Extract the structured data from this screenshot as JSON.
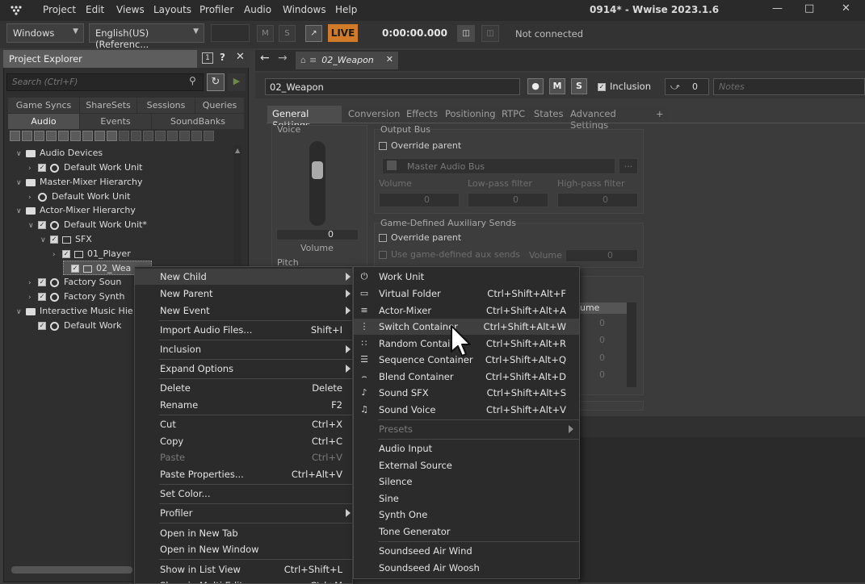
{
  "app": {
    "title": "0914* - Wwise 2023.1.6"
  },
  "menubar": [
    "Project",
    "Edit",
    "Views",
    "Layouts",
    "Profiler",
    "Audio",
    "Windows",
    "Help"
  ],
  "toolbar": {
    "layout_dropdown": "Windows",
    "language_dropdown": "English(US) (Referenc...",
    "mute_label": "M",
    "solo_label": "S",
    "live_label": "LIVE",
    "timecode": "0:00:00.000",
    "connection_status": "Not connected"
  },
  "project_explorer": {
    "title": "Project Explorer",
    "badge": "1",
    "search_placeholder": "Search (Ctrl+F)",
    "tabs_row1": [
      "Game Syncs",
      "ShareSets",
      "Sessions",
      "Queries"
    ],
    "tabs_row2": [
      "Audio",
      "Events",
      "SoundBanks"
    ],
    "tree": [
      {
        "label": "Audio Devices"
      },
      {
        "label": "Default Work Unit"
      },
      {
        "label": "Master-Mixer Hierarchy"
      },
      {
        "label": "Default Work Unit"
      },
      {
        "label": "Actor-Mixer Hierarchy"
      },
      {
        "label": "Default Work Unit*"
      },
      {
        "label": "SFX"
      },
      {
        "label": "01_Player"
      },
      {
        "label": "02_Wea"
      },
      {
        "label": "Factory Soun"
      },
      {
        "label": "Factory Synth"
      },
      {
        "label": "Interactive Music Hie"
      },
      {
        "label": "Default Work"
      }
    ]
  },
  "property_editor": {
    "tab_title": "02_Weapon",
    "object_name": "02_Weapon",
    "mute_label": "M",
    "solo_label": "S",
    "inclusion_label": "Inclusion",
    "share_count": "0",
    "notes_placeholder": "Notes",
    "tabs": [
      "General Settings",
      "Conversion",
      "Effects",
      "Positioning",
      "RTPC",
      "States",
      "Advanced Settings",
      "+"
    ],
    "voice_label": "Voice",
    "volume_value": "0",
    "volume_label": "Volume",
    "pitch_label": "Pitch",
    "output_bus_label": "Output Bus",
    "override_parent_label": "Override parent",
    "master_bus": "Master Audio Bus",
    "browse_label": "...",
    "bus_fields": [
      {
        "label": "Volume",
        "value": "0"
      },
      {
        "label": "Low-pass filter",
        "value": "0"
      },
      {
        "label": "High-pass filter",
        "value": "0"
      }
    ],
    "aux_sends_label": "Game-Defined Auxiliary Sends",
    "aux_override_label": "Override parent",
    "use_aux_label": "Use game-defined aux sends",
    "aux_volume_label": "Volume",
    "aux_volume_value": "0",
    "table_header": "ume",
    "table_values": [
      "0",
      "0",
      "0",
      "0"
    ]
  },
  "context_menu": {
    "items": [
      {
        "label": "New Child",
        "shortcut": "",
        "submenu": true
      },
      {
        "label": "New Parent",
        "shortcut": "",
        "submenu": true
      },
      {
        "label": "New Event",
        "shortcut": "",
        "submenu": true
      },
      {
        "label": "Import Audio Files...",
        "shortcut": "Shift+I"
      },
      {
        "label": "Inclusion",
        "shortcut": "",
        "submenu": true
      },
      {
        "label": "Expand Options",
        "shortcut": "",
        "submenu": true
      },
      {
        "label": "Delete",
        "shortcut": "Delete"
      },
      {
        "label": "Rename",
        "shortcut": "F2"
      },
      {
        "label": "Cut",
        "shortcut": "Ctrl+X"
      },
      {
        "label": "Copy",
        "shortcut": "Ctrl+C"
      },
      {
        "label": "Paste",
        "shortcut": "Ctrl+V"
      },
      {
        "label": "Paste Properties...",
        "shortcut": "Ctrl+Alt+V"
      },
      {
        "label": "Set Color...",
        "shortcut": ""
      },
      {
        "label": "Profiler",
        "shortcut": "",
        "submenu": true
      },
      {
        "label": "Open in New Tab",
        "shortcut": ""
      },
      {
        "label": "Open in New Window",
        "shortcut": ""
      },
      {
        "label": "Show in List View",
        "shortcut": "Ctrl+Shift+L"
      },
      {
        "label": "Show in Multi Edit",
        "shortcut": "Ctrl+M"
      }
    ]
  },
  "submenu": {
    "items": [
      {
        "label": "Work Unit",
        "shortcut": ""
      },
      {
        "label": "Virtual Folder",
        "shortcut": "Ctrl+Shift+Alt+F"
      },
      {
        "label": "Actor-Mixer",
        "shortcut": "Ctrl+Shift+Alt+A"
      },
      {
        "label": "Switch Container",
        "shortcut": "Ctrl+Shift+Alt+W"
      },
      {
        "label": "Random Container",
        "shortcut": "Ctrl+Shift+Alt+R"
      },
      {
        "label": "Sequence Container",
        "shortcut": "Ctrl+Shift+Alt+Q"
      },
      {
        "label": "Blend Container",
        "shortcut": "Ctrl+Shift+Alt+D"
      },
      {
        "label": "Sound SFX",
        "shortcut": "Ctrl+Shift+Alt+S"
      },
      {
        "label": "Sound Voice",
        "shortcut": "Ctrl+Shift+Alt+V"
      },
      {
        "label": "Presets",
        "shortcut": ""
      },
      {
        "label": "Audio Input",
        "shortcut": ""
      },
      {
        "label": "External Source",
        "shortcut": ""
      },
      {
        "label": "Silence",
        "shortcut": ""
      },
      {
        "label": "Sine",
        "shortcut": ""
      },
      {
        "label": "Synth One",
        "shortcut": ""
      },
      {
        "label": "Tone Generator",
        "shortcut": ""
      },
      {
        "label": "Soundseed Air Wind",
        "shortcut": ""
      },
      {
        "label": "Soundseed Air Woosh",
        "shortcut": ""
      }
    ]
  },
  "colors": {
    "live": "#d07a2a",
    "menu_bg": "#2b2b2b",
    "highlight": "#3f3f3f"
  }
}
